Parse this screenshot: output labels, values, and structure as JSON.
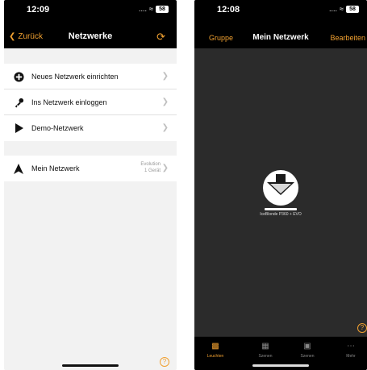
{
  "left": {
    "status": {
      "time": "12:09",
      "signal": "....",
      "battery": "58"
    },
    "nav": {
      "back_label": "Zurück",
      "title": "Netzwerke"
    },
    "section1": [
      {
        "label": "Neues Netzwerk einrichten",
        "icon": "plus-circle-icon"
      },
      {
        "label": "Ins Netzwerk einloggen",
        "icon": "key-icon"
      },
      {
        "label": "Demo-Netzwerk",
        "icon": "play-icon"
      }
    ],
    "section2": [
      {
        "label": "Mein Netzwerk",
        "icon": "network-arrow-icon",
        "detail_line1": "Evolution",
        "detail_line2": "1 Gerät"
      }
    ],
    "help": "?"
  },
  "right": {
    "status": {
      "time": "12:08",
      "signal": "....",
      "battery": "58"
    },
    "nav": {
      "left_label": "Gruppe",
      "title": "Mein Netzwerk",
      "right_label": "Bearbeiten"
    },
    "device": {
      "label": "IceBlonde P360 + EVO"
    },
    "help": "?",
    "tabs": [
      {
        "label": "Leuchten",
        "icon": "lamp-icon",
        "active": true
      },
      {
        "label": "Szenen",
        "icon": "scenes-icon",
        "active": false
      },
      {
        "label": "Szenen",
        "icon": "clapper-icon",
        "active": false
      },
      {
        "label": "Mehr",
        "icon": "more-icon",
        "active": false
      }
    ]
  },
  "colors": {
    "accent": "#f0a030",
    "dark_bg": "#2b2b2b",
    "bar_bg": "#000000",
    "light_bg": "#f2f2f2"
  }
}
